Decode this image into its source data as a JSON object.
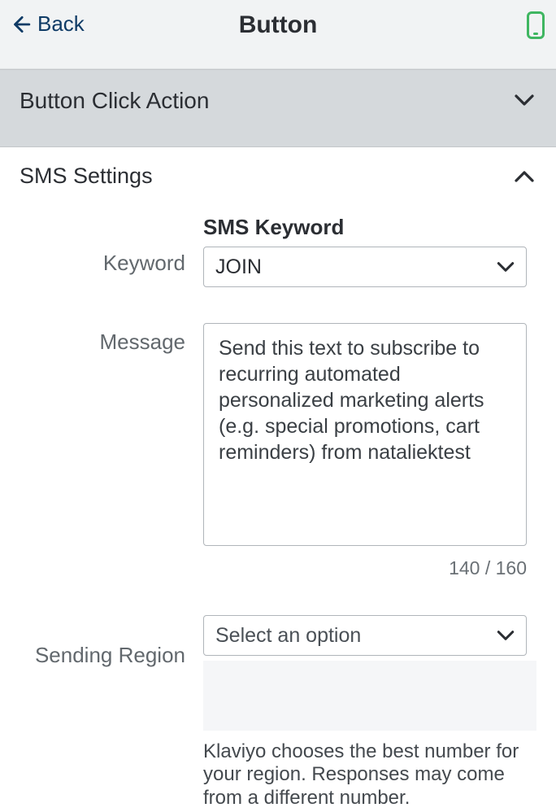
{
  "header": {
    "back_label": "Back",
    "title": "Button"
  },
  "section_collapsed": {
    "title": "Button Click Action"
  },
  "section_expanded": {
    "title": "SMS Settings"
  },
  "form": {
    "keyword": {
      "row_label": "Keyword",
      "field_label": "SMS Keyword",
      "selected": "JOIN"
    },
    "message": {
      "row_label": "Message",
      "value": "Send this text to subscribe to recurring automated personalized marketing alerts (e.g. special promotions, cart reminders) from nataliektest",
      "counter": "140 / 160"
    },
    "region": {
      "row_label": "Sending Region",
      "placeholder": "Select an option",
      "helper": "Klaviyo chooses the best number for your region. Responses may come from a different number."
    }
  }
}
